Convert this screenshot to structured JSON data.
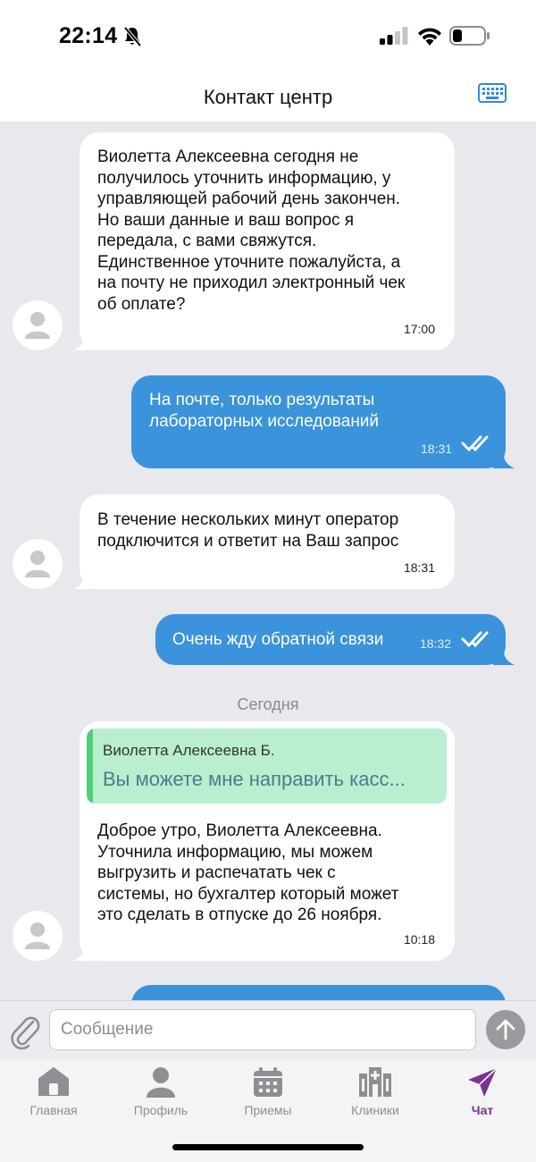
{
  "status_bar": {
    "time": "22:14"
  },
  "header": {
    "title": "Контакт центр"
  },
  "messages": [
    {
      "direction": "in",
      "lines": [
        "Виолетта Алексеевна сегодня не",
        "получилось уточнить информацию, у",
        "управляющей рабочий день закончен.",
        "Но ваши данные и ваш вопрос я",
        "передала, с вами свяжутся.",
        "Единственное уточните пожалуйста, а",
        "на почту не приходил электронный чек",
        "об оплате?"
      ],
      "time": "17:00"
    },
    {
      "direction": "out",
      "lines": [
        "На почте, только результаты",
        "лабораторных исследований"
      ],
      "time": "18:31",
      "status": "read"
    },
    {
      "direction": "in",
      "lines": [
        "В течение нескольких минут оператор",
        "подключится и ответит на Ваш запрос"
      ],
      "time": "18:31"
    },
    {
      "direction": "out",
      "lines": [
        "Очень жду обратной связи"
      ],
      "time": "18:32",
      "status": "read"
    },
    {
      "direction": "in",
      "quote": {
        "author": "Виолетта Алексеевна Б.",
        "text": "Вы можете мне направить касс..."
      },
      "lines": [
        "Доброе утро, Виолетта Алексеевна.",
        "Уточнила информацию, мы можем",
        "выгрузить и распечатать чек с",
        "системы, но бухгалтер который может",
        "это сделать в отпуске до 26 ноября."
      ],
      "time": "10:18"
    }
  ],
  "day_separator": "Сегодня",
  "composer": {
    "placeholder": "Сообщение"
  },
  "tabbar": {
    "active": "chat",
    "active_color": "#7d3394",
    "items": [
      {
        "label": "Главная",
        "icon": "home-icon"
      },
      {
        "label": "Профиль",
        "icon": "person-icon"
      },
      {
        "label": "Приемы",
        "icon": "calendar-icon"
      },
      {
        "label": "Клиники",
        "icon": "clinic-icon"
      },
      {
        "label": "Чат",
        "icon": "send-plane-icon"
      }
    ]
  },
  "colors": {
    "outgoing_bubble": "#3a93db",
    "incoming_bubble": "#ffffff",
    "background": "#e8e8ed",
    "quote_bg": "#b9efcf",
    "quote_bar": "#4ccf7c"
  }
}
